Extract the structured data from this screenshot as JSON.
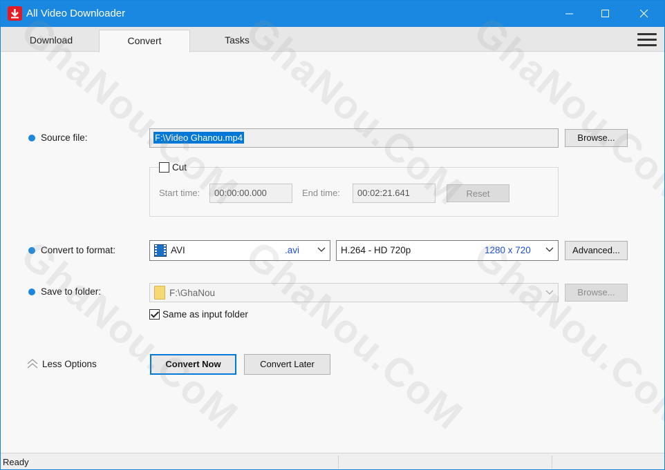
{
  "window": {
    "title": "All Video Downloader"
  },
  "tabs": [
    {
      "label": "Download"
    },
    {
      "label": "Convert"
    },
    {
      "label": "Tasks"
    }
  ],
  "form": {
    "source_label": "Source file:",
    "source_value": "F:\\Video Ghanou.mp4",
    "browse_label": "Browse...",
    "cut_label": "Cut",
    "start_label": "Start time:",
    "start_value": "00:00:00.000",
    "end_label": "End time:",
    "end_value": "00:02:21.641",
    "reset_label": "Reset",
    "format_label": "Convert to format:",
    "format_name": "AVI",
    "format_ext": ".avi",
    "codec_name": "H.264 - HD 720p",
    "codec_res": "1280 x 720",
    "advanced_label": "Advanced...",
    "folder_label": "Save to folder:",
    "folder_value": "F:\\GhaNou",
    "folder_browse_label": "Browse...",
    "same_folder_label": "Same as input folder",
    "less_options_label": "Less Options",
    "convert_now_label": "Convert Now",
    "convert_later_label": "Convert Later"
  },
  "status": {
    "text": "Ready"
  },
  "watermark": {
    "text": "GhaNou.CoM"
  },
  "colors": {
    "accent": "#1a88e0",
    "brand_red": "#e41b23",
    "link_blue": "#1a4fd8"
  }
}
